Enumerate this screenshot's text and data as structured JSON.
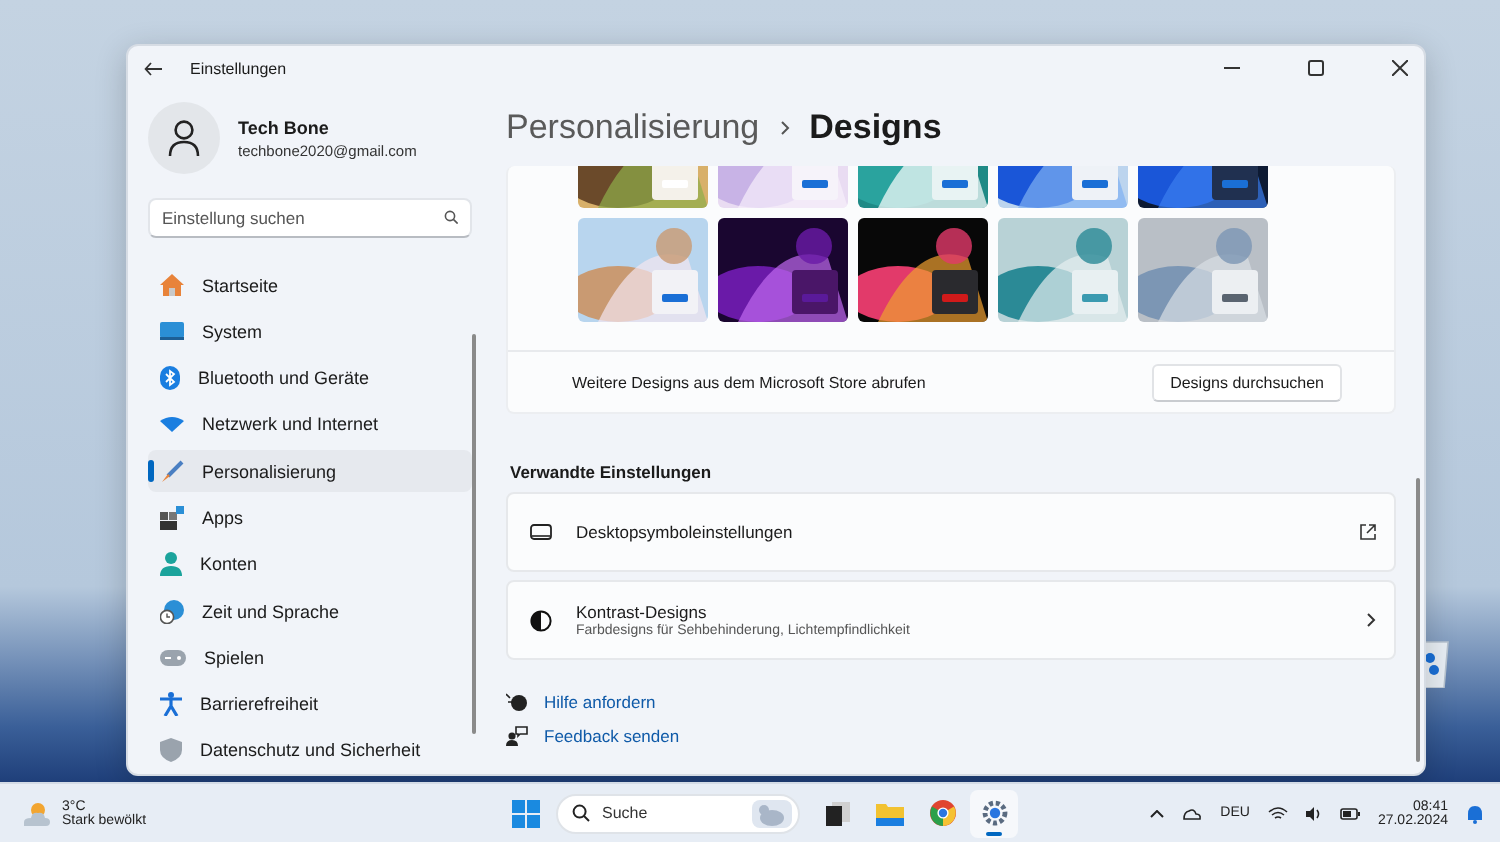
{
  "window": {
    "title": "Einstellungen"
  },
  "account": {
    "name": "Tech Bone",
    "email": "techbone2020@gmail.com"
  },
  "search": {
    "placeholder": "Einstellung suchen"
  },
  "sidebar": {
    "items": [
      {
        "label": "Startseite",
        "selected": false
      },
      {
        "label": "System",
        "selected": false
      },
      {
        "label": "Bluetooth und Geräte",
        "selected": false
      },
      {
        "label": "Netzwerk und Internet",
        "selected": false
      },
      {
        "label": "Personalisierung",
        "selected": true
      },
      {
        "label": "Apps",
        "selected": false
      },
      {
        "label": "Konten",
        "selected": false
      },
      {
        "label": "Zeit und Sprache",
        "selected": false
      },
      {
        "label": "Spielen",
        "selected": false
      },
      {
        "label": "Barrierefreiheit",
        "selected": false
      },
      {
        "label": "Datenschutz und Sicherheit",
        "selected": false
      }
    ]
  },
  "breadcrumb": {
    "parent": "Personalisierung",
    "current": "Designs"
  },
  "store_row": {
    "text": "Weitere Designs aus dem Microsoft Store abrufen",
    "button": "Designs durchsuchen"
  },
  "related": {
    "heading": "Verwandte Einstellungen",
    "items": [
      {
        "kind": "external",
        "title": "Desktopsymboleinstellungen"
      },
      {
        "kind": "chevron",
        "title": "Kontrast-Designs",
        "subtitle": "Farbdesigns für Sehbehinderung, Lichtempfindlichkeit"
      }
    ]
  },
  "help_links": [
    {
      "kind": "help",
      "label": "Hilfe anfordern"
    },
    {
      "kind": "feedback",
      "label": "Feedback senden"
    }
  ],
  "taskbar": {
    "weather": {
      "temp": "3°C",
      "condition": "Stark bewölkt"
    },
    "search_placeholder": "Suche",
    "apps": [
      {
        "kind": "taskview",
        "selected": false
      },
      {
        "kind": "explorer",
        "selected": false
      },
      {
        "kind": "browser",
        "selected": false
      },
      {
        "kind": "settings",
        "selected": true
      }
    ],
    "language": "DEU",
    "time": "08:41",
    "date": "27.02.2024"
  }
}
